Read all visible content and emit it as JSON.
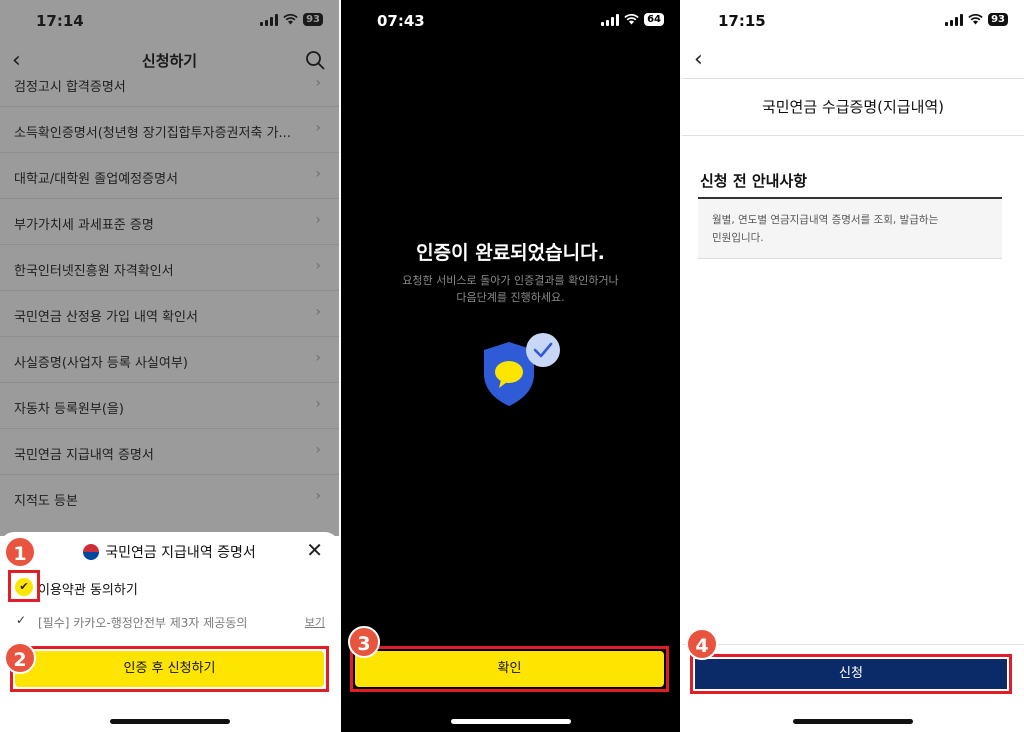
{
  "colors": {
    "kakao_yellow": "#fee500",
    "highlight_red": "#e11d26",
    "badge_orange": "#e9543f",
    "navy": "#0b2a68",
    "shield_blue": "#2f5bd6"
  },
  "panel1": {
    "status": {
      "time": "17:14",
      "battery": "93"
    },
    "header": {
      "title": "신청하기",
      "back_icon": "chevron-left-icon",
      "search_icon": "search-icon"
    },
    "documents": [
      {
        "label": "검정고시 합격증명서"
      },
      {
        "label": "소득확인증명서(청년형 장기집합투자증권저축 가..."
      },
      {
        "label": "대학교/대학원 졸업예정증명서"
      },
      {
        "label": "부가가치세 과세표준 증명"
      },
      {
        "label": "한국인터넷진흥원 자격확인서"
      },
      {
        "label": "국민연금 산정용 가입 내역 확인서"
      },
      {
        "label": "사실증명(사업자 등록 사실여부)"
      },
      {
        "label": "자동차 등록원부(을)"
      },
      {
        "label": "국민연금 지급내역 증명서"
      },
      {
        "label": "지적도 등본"
      }
    ],
    "sheet": {
      "title": "국민연금 지급내역 증명서",
      "agree_all": "이용약관 동의하기",
      "consent_item": "[필수] 카카오-행정안전부 제3자 제공동의",
      "view_link": "보기",
      "submit_button": "인증 후 신청하기"
    },
    "badges": {
      "step1": "1",
      "step2": "2"
    }
  },
  "panel2": {
    "status": {
      "time": "07:43",
      "battery": "64"
    },
    "title": "인증이 완료되었습니다.",
    "description_line1": "요청한 서비스로 돌아가 인증결과를 확인하거나",
    "description_line2": "다음단계를 진행하세요.",
    "confirm_button": "확인",
    "badge": "3"
  },
  "panel3": {
    "status": {
      "time": "17:15",
      "battery": "93"
    },
    "title": "국민연금 수급증명(지급내역)",
    "section_title": "신청 전 안내사항",
    "notice_line1": "월별, 연도별 연금지급내역 증명서를 조회, 발급하는",
    "notice_line2": "민원입니다.",
    "apply_button": "신청",
    "badge": "4"
  }
}
